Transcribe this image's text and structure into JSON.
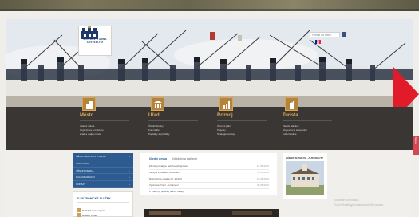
{
  "logo": {
    "text_line1": "SLAVKOV U BRNA",
    "text_line2": "AUSTERLITZ"
  },
  "search": {
    "placeholder": "Hledat na webu"
  },
  "flags": [
    {
      "name": "czech-flag-icon",
      "colors": [
        "#ffffff",
        "#d7141a",
        "#11457e"
      ]
    },
    {
      "name": "uk-flag-icon",
      "colors": [
        "#012169",
        "#ffffff",
        "#c8102e"
      ]
    },
    {
      "name": "german-flag-icon",
      "colors": [
        "#000000",
        "#dd0000",
        "#ffce00"
      ]
    },
    {
      "name": "french-flag-icon",
      "colors": [
        "#002395",
        "#ffffff",
        "#ed2939"
      ]
    }
  ],
  "nav": [
    {
      "title": "Město",
      "icon": "city-icon",
      "links": [
        "Vedení města",
        "Organizace a instituce",
        "Znak a vlajka města"
      ]
    },
    {
      "title": "Úřad",
      "icon": "office-icon",
      "links": [
        "Úřední hodiny",
        "Formuláře",
        "Poplatky a vyhlášky"
      ]
    },
    {
      "title": "Rozvoj",
      "icon": "chart-icon",
      "links": [
        "Územní plán",
        "Projekty",
        "Strategie rozvoje"
      ]
    },
    {
      "title": "Turista",
      "icon": "luggage-icon",
      "links": [
        "Zámek Slavkov",
        "Ubytování a stravování",
        "Kulturní akce"
      ]
    }
  ],
  "sidetab": {
    "label": "Mapa"
  },
  "blue_menu": [
    "MĚSTO SLAVKOV U BRNA",
    "AKTUALITY",
    "ÚŘEDNÍ DESKA",
    "KALENDÁŘ AKCÍ",
    "ODKAZY"
  ],
  "sidebox": {
    "title": "ELEKTRONICKÉ SLUŽBY",
    "items": [
      "Rozklikávací rozpočet",
      "Hlášení závad"
    ]
  },
  "news": {
    "tabs": [
      "Úřední deska",
      "Vyhlášky a nařízení"
    ],
    "rows": [
      {
        "text": "Záměr pronájmu nebytových prostor",
        "date": "12.05.2016"
      },
      {
        "text": "Veřejná vyhláška - oznámení",
        "date": "11.05.2016"
      },
      {
        "text": "Rozpočtové opatření č. 2/2016",
        "date": "10.05.2016"
      },
      {
        "text": "Výběrové řízení - oznámení",
        "date": "09.05.2016"
      }
    ],
    "more": "» Všechny položky úřední desky"
  },
  "castle": {
    "title": "ZÁMEK SLAVKOV - AUSTERLITZ"
  },
  "watermark": {
    "line1": "Activate Windows",
    "line2": "Go to Settings to activate Windows."
  },
  "colors": {
    "nav_band": "#3a3633",
    "accent_gold": "#d9a95d",
    "menu_blue": "#2d5a8f",
    "arrow_red": "#e21b2a"
  }
}
